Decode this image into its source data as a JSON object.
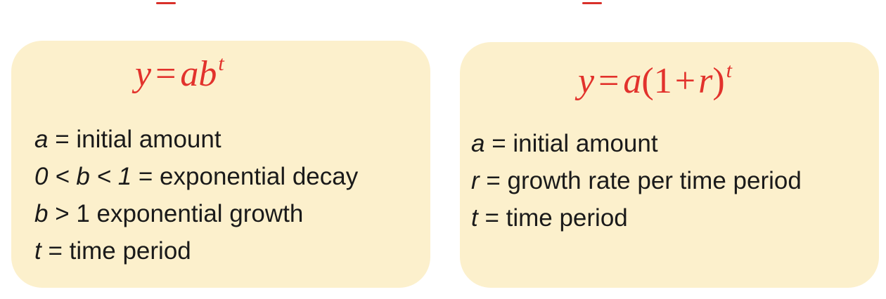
{
  "left_card": {
    "formula": {
      "y": "y",
      "equals": "=",
      "base_a": "a",
      "base_b": "b",
      "exponent": "t"
    },
    "definitions": [
      {
        "symbol": "a",
        "text": " = initial amount"
      },
      {
        "symbol": "0 < b < 1",
        "text": " = exponential decay"
      },
      {
        "symbol": "b",
        "text": " > 1 exponential growth"
      },
      {
        "symbol": "t",
        "text": " = time period"
      }
    ]
  },
  "right_card": {
    "formula": {
      "y": "y",
      "equals": "=",
      "a": "a",
      "open_paren": "(",
      "one": "1",
      "plus": "+",
      "r": "r",
      "close_paren": ")",
      "exponent": "t"
    },
    "definitions": [
      {
        "symbol": "a",
        "text": " = initial amount"
      },
      {
        "symbol": "r",
        "text": " = growth rate per time period"
      },
      {
        "symbol": "t",
        "text": " = time period"
      }
    ]
  },
  "colors": {
    "card_background": "#fcf0cc",
    "formula_red": "#e2322c",
    "text": "#1a1a1a"
  }
}
